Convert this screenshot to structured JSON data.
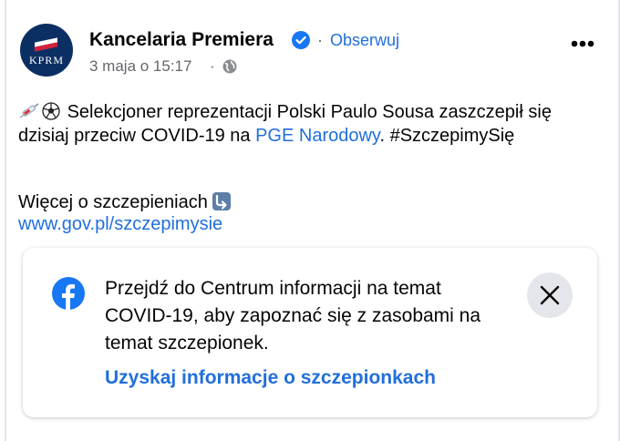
{
  "post": {
    "page_name": "Kancelaria Premiera",
    "follow_label": "Obserwuj",
    "separator": "·",
    "date": "3 maja o 15:17",
    "avatar_text": "KPRM",
    "text_part1": "Selekcjoner reprezentacji Polski Paulo Sousa zaszczepił się dzisiaj przeciw COVID-19 na ",
    "text_link": "PGE Narodowy",
    "text_part2": ". #SzczepimySię",
    "more_info": "Więcej o szczepieniach",
    "url": "www.gov.pl/szczepimysie",
    "icons": {
      "verified": "verified-badge-icon",
      "audience": "globe-icon",
      "menu": "more-options-icon",
      "emoji1": "syringe-icon",
      "emoji2": "soccer-ball-icon",
      "emoji3": "arrow-down-right-icon"
    }
  },
  "info_card": {
    "body": "Przejdź do Centrum informacji na temat COVID-19, aby zapoznać się z zasobami na temat szczepionek.",
    "link": "Uzyskaj informacje o szczepionkach",
    "icons": {
      "brand": "facebook-logo-icon",
      "close": "close-icon"
    }
  },
  "colors": {
    "link": "#216fdb",
    "secondary_text": "#65676b",
    "primary_text": "#050505",
    "avatar_bg": "#0c2f63",
    "close_button_bg": "#e4e6eb"
  }
}
